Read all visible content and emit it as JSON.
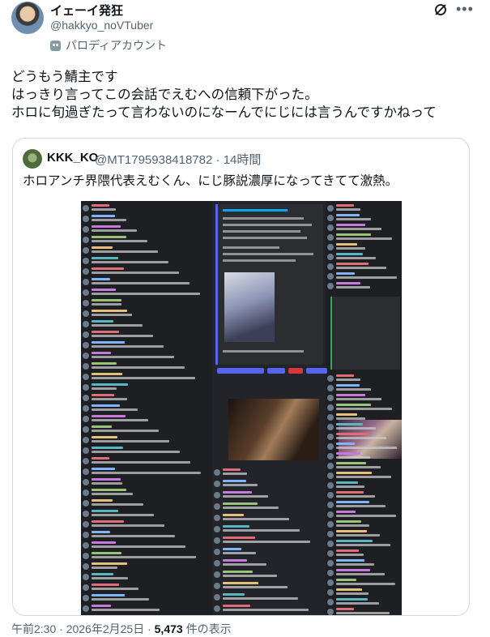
{
  "author": {
    "name": "イェーイ発狂",
    "handle": "@hakkyo_noVTuber",
    "badge": "パロディアカウント"
  },
  "tweet": {
    "lines": [
      "どうもう鯖主です",
      "はっきり言ってこの会話でえむへの信頼下がった。",
      "ホロに旬過ぎたって言わないのになーんでにじには言うんですかねって"
    ]
  },
  "quote": {
    "name": "KKK_KO",
    "handle": "@MT1795938418782",
    "time": "14時間",
    "text": "ホロアンチ界隈代表えむくん、にじ豚説濃厚になってきてて激熱。"
  },
  "footer": {
    "time": "午前2:30 · 2026年2月25日 · ",
    "views_number": "5,473",
    "views_label": " 件の表示"
  },
  "icons": {
    "avatar": "avatar-image",
    "slash": "slash-circle-icon",
    "more": "more-icon",
    "badge": "mask-icon"
  },
  "colors": {
    "text": "#0f1419",
    "secondary": "#536471",
    "border": "#cfd9de",
    "discord_bg": "#1e1f22",
    "discord_accent": "#5865f2"
  }
}
